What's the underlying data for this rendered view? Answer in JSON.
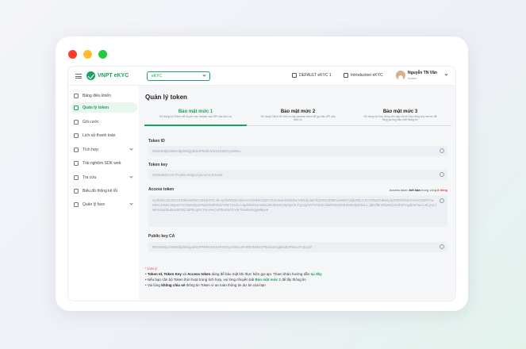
{
  "window_dots": [
    "#ff3b30",
    "#ffbd2e",
    "#27c93f"
  ],
  "brand": {
    "logo_text": "VNPT eKYC",
    "accent": "#1aa260"
  },
  "header": {
    "env_select": "eKYC",
    "default_link": "DEFAULT eKYC 1",
    "intro_link": "Introduction eKYC",
    "user_name": "Nguyễn TN Văn",
    "user_role": "Admin"
  },
  "sidebar": {
    "items": [
      {
        "label": "Bảng điều khiển",
        "icon": "dashboard-icon"
      },
      {
        "label": "Quản lý token",
        "icon": "key-icon",
        "active": true
      },
      {
        "label": "Gói cước",
        "icon": "package-icon"
      },
      {
        "label": "Lịch sử thanh toán",
        "icon": "history-icon"
      },
      {
        "label": "Tích hợp",
        "icon": "integration-icon",
        "expandable": true
      },
      {
        "label": "Trải nghiệm SDK web",
        "icon": "sdk-icon"
      },
      {
        "label": "Tra cứu",
        "icon": "lookup-icon",
        "expandable": true
      },
      {
        "label": "Biểu đồ thống kê lỗi",
        "icon": "chart-icon"
      },
      {
        "label": "Quản lý face",
        "icon": "face-icon",
        "expandable": true
      }
    ]
  },
  "main": {
    "title": "Quản lý token",
    "tabs": [
      {
        "title": "Bảo mật mức 1",
        "desc": "Sử dụng bộ Token để truyền vào header các API của dịch vụ"
      },
      {
        "title": "Bảo mật mức 2",
        "desc": "Sử dụng Client ID sinh ra cặp access token để gọi các API của dịch vụ"
      },
      {
        "title": "Bảo mật mức 3",
        "desc": "Sử dụng bộ Key riêng cho app và bộ Key riêng cho server để tăng cường bảo mật thông tin"
      }
    ],
    "fields": {
      "token_id": {
        "label": "Token ID",
        "value": "REBSMlpzNWtHbjdWUjpMSxPM3lzSW1ZSsDGyVWw="
      },
      "token_key": {
        "label": "Token key",
        "value": "SXNw6deYvKTAQBCXMgc2QLmxVUKNoW"
      },
      "access_token": {
        "label": "Access token",
        "value": "eyJhbGciOiJSUzI1NiIsInR5cCI6IkpXVCJ9.eyJhdWQiOlsicmVzdHNlcnZpY2UiXSwidXNlcl9uYW1lIjoiaGlkZXRmZ0BAaWNlYy5jb20iLCJzY29wZSI6WyJyZWFkIl0sImV4cCI6MTYwMDU1NzE1MywiYXV0aG9yaXRpZXMiOlsiVVNFUiJdLCJqdGkiOiJmNDc2N2E5ZC0yNjVhLTQzZjAtYTVhMC1kMTM1ZGE0MDZjNDkiLCJjbGllbnRfaWQiOiJhZG1pbmFwcCJ9.yVLfWr2O5JfZuB1x8ONZJdFkLqRzT3mVeCwPbA0sGhYiK7Dn9Ut4QjMl6pHr",
        "note_prefix": "Access token ",
        "note_bold": "hết hạn",
        "note_mid": " trong vòng ",
        "note_red": "8 tiếng"
      },
      "public_key": {
        "label": "Public key CA",
        "value": "REBSMlpzNWtHbjdWUjpMSxPM3lzSW1ZSsDGyVWw=RHB67BMNcFBDIxaArg8NdURW447cdryaff"
      }
    },
    "notes": {
      "heading": "* Lưu ý:",
      "line1_a": "Token Id, Token Key",
      "line1_b": " và ",
      "line1_c": "Access token",
      "line1_d": " dùng để bảo mật khi thực hiện gọi api. Tham khảo hướng dẫn ",
      "line1_e": "tại đây",
      "line2_a": "Nếu bạn cần bộ Token thời hoạt trong tích hợp, vui lòng chuyển tab ",
      "line2_b": "Bảo mật mức 2",
      "line2_c": " để lấy thông tin",
      "line3_a": "Vui lòng ",
      "line3_b": "không chia sẻ",
      "line3_c": " thông tin Token vì an toàn thông tin dự án của bạn"
    }
  }
}
